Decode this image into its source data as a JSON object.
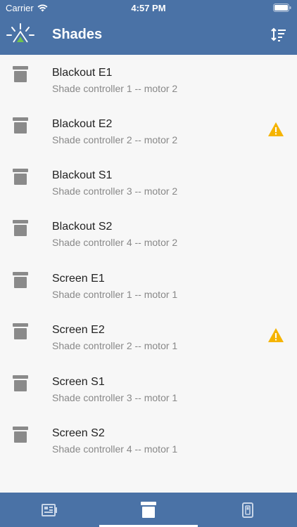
{
  "status_bar": {
    "carrier": "Carrier",
    "time": "4:57 PM"
  },
  "header": {
    "title": "Shades"
  },
  "shades": [
    {
      "name": "Blackout E1",
      "detail": "Shade controller 1 -- motor 2",
      "warning": false
    },
    {
      "name": "Blackout E2",
      "detail": "Shade controller 2 -- motor 2",
      "warning": true
    },
    {
      "name": "Blackout S1",
      "detail": "Shade controller 3 -- motor 2",
      "warning": false
    },
    {
      "name": "Blackout S2",
      "detail": "Shade controller 4 -- motor 2",
      "warning": false
    },
    {
      "name": "Screen E1",
      "detail": "Shade controller 1 -- motor 1",
      "warning": false
    },
    {
      "name": "Screen E2",
      "detail": "Shade controller 2 -- motor 1",
      "warning": true
    },
    {
      "name": "Screen S1",
      "detail": "Shade controller 3 -- motor 1",
      "warning": false
    },
    {
      "name": "Screen S2",
      "detail": "Shade controller 4 -- motor 1",
      "warning": false
    }
  ],
  "tabs": [
    {
      "icon": "dashboard-icon",
      "selected": false
    },
    {
      "icon": "shade-icon",
      "selected": true
    },
    {
      "icon": "switch-icon",
      "selected": false
    }
  ],
  "colors": {
    "accent": "#4a72a6",
    "warning": "#f5b400",
    "icon_gray": "#8a8a8a"
  }
}
